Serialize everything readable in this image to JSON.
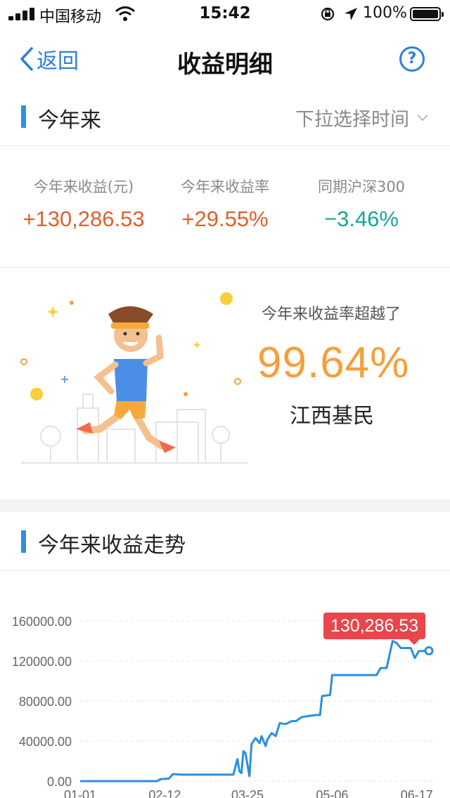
{
  "status_bar": {
    "carrier": "中国移动",
    "time": "15:42",
    "battery": "100%"
  },
  "nav": {
    "back_label": "返回",
    "title": "收益明细",
    "help_label": "?"
  },
  "period": {
    "title": "今年来",
    "selector_label": "下拉选择时间"
  },
  "stats": [
    {
      "label": "今年来收益(元)",
      "value": "+130,286.53",
      "color": "#e0602c"
    },
    {
      "label": "今年来收益率",
      "value": "+29.55%",
      "color": "#e0602c"
    },
    {
      "label": "同期沪深300",
      "value": "−3.46%",
      "color": "#1aa39a"
    }
  ],
  "ranking": {
    "caption": "今年来收益率超越了",
    "value": "99.64%",
    "group": "江西基民"
  },
  "trend": {
    "title": "今年来收益走势",
    "tooltip": "130,286.53"
  },
  "chart_data": {
    "type": "line",
    "ylim": [
      0,
      160000
    ],
    "y_ticks": [
      "160000.00",
      "120000.00",
      "80000.00",
      "40000.00",
      "0.00"
    ],
    "x_ticks": [
      "01-01",
      "02-12",
      "03-25",
      "05-06",
      "06-17"
    ],
    "line_color": "#2b8fde",
    "highlight_color": "#e8464b",
    "series": [
      {
        "values": [
          [
            "01-01",
            0
          ],
          [
            "01-20",
            0
          ],
          [
            "02-08",
            0
          ],
          [
            "02-10",
            2000
          ],
          [
            "02-14",
            2500
          ],
          [
            "02-16",
            7000
          ],
          [
            "02-20",
            6500
          ],
          [
            "03-01",
            6500
          ],
          [
            "03-18",
            6500
          ],
          [
            "03-20",
            22000
          ],
          [
            "03-21",
            10000
          ],
          [
            "03-22",
            8000
          ],
          [
            "03-23",
            30000
          ],
          [
            "03-24",
            28000
          ],
          [
            "03-26",
            5000
          ],
          [
            "03-27",
            37000
          ],
          [
            "03-29",
            43000
          ],
          [
            "03-31",
            38000
          ],
          [
            "04-01",
            45000
          ],
          [
            "04-03",
            35000
          ],
          [
            "04-04",
            42000
          ],
          [
            "04-06",
            48000
          ],
          [
            "04-08",
            45000
          ],
          [
            "04-10",
            58000
          ],
          [
            "04-13",
            57000
          ],
          [
            "04-16",
            60000
          ],
          [
            "04-18",
            60000
          ],
          [
            "04-21",
            64000
          ],
          [
            "04-24",
            65000
          ],
          [
            "04-28",
            66000
          ],
          [
            "04-30",
            66000
          ],
          [
            "05-01",
            85000
          ],
          [
            "05-05",
            86000
          ],
          [
            "05-06",
            106000
          ],
          [
            "05-10",
            106000
          ],
          [
            "05-20",
            106000
          ],
          [
            "05-28",
            106000
          ],
          [
            "05-30",
            113000
          ],
          [
            "06-02",
            113000
          ],
          [
            "06-05",
            140000
          ],
          [
            "06-07",
            138000
          ],
          [
            "06-09",
            133000
          ],
          [
            "06-11",
            133000
          ],
          [
            "06-14",
            133000
          ],
          [
            "06-16",
            123000
          ],
          [
            "06-18",
            130000
          ],
          [
            "06-20",
            130000
          ],
          [
            "06-23",
            130286.53
          ]
        ]
      }
    ]
  }
}
